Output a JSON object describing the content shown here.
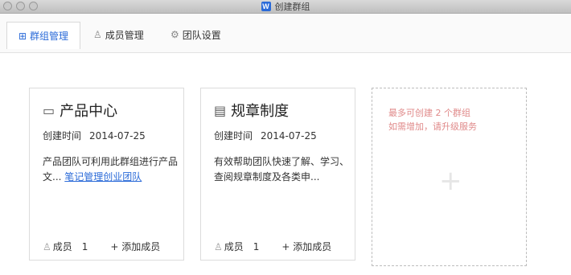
{
  "window": {
    "title": "创建群组",
    "app_icon": "W"
  },
  "tabs": [
    {
      "label": "群组管理",
      "icon": "group-manage-icon",
      "active": true
    },
    {
      "label": "成员管理",
      "icon": "members-icon",
      "active": false
    },
    {
      "label": "团队设置",
      "icon": "gear-icon",
      "active": false
    }
  ],
  "cards": [
    {
      "icon": "monitor-icon",
      "title": "产品中心",
      "created_label": "创建时间",
      "created_date": "2014-07-25",
      "desc_text": "产品团队可利用此群组进行产品文...",
      "desc_link": "笔记管理创业团队",
      "members_label": "成员",
      "members_count": "1",
      "add_label": "+ 添加成员"
    },
    {
      "icon": "document-icon",
      "title": "规章制度",
      "created_label": "创建时间",
      "created_date": "2014-07-25",
      "desc_text": "有效帮助团队快速了解、学习、查阅规章制度及各类申...",
      "desc_link": "",
      "members_label": "成员",
      "members_count": "1",
      "add_label": "+ 添加成员"
    }
  ],
  "add_card": {
    "limit_line1": "最多可创建 2 个群组",
    "limit_line2": "如需增加，请升级服务",
    "plus": "+"
  },
  "colors": {
    "accent": "#2a6ad8",
    "limit_text": "#e08a8a",
    "border": "#dcdcdc"
  }
}
